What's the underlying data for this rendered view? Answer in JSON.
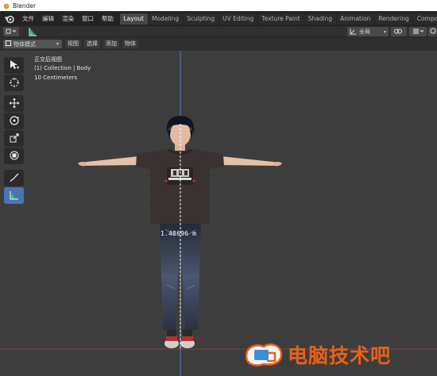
{
  "window": {
    "title": "Blender"
  },
  "menu": {
    "items": [
      "文件",
      "编辑",
      "渲染",
      "窗口",
      "帮助"
    ]
  },
  "workspaces": {
    "tabs": [
      "Layout",
      "Modeling",
      "Sculpting",
      "UV Editing",
      "Texture Paint",
      "Shading",
      "Animation",
      "Rendering",
      "Compositing"
    ],
    "active": "Layout"
  },
  "header": {
    "transform_orientation": "全局"
  },
  "viewport_header": {
    "mode": "物体模式",
    "menus": [
      "视图",
      "选择",
      "添加",
      "物体"
    ]
  },
  "overlay": {
    "view_name": "正交后视图",
    "collection": "(1) Collection | Body",
    "scale": "10 Centimeters"
  },
  "toolbar": {
    "tools": [
      "select-box",
      "cursor",
      "move",
      "rotate",
      "scale",
      "transform",
      "annotate",
      "measure"
    ],
    "active_tool": "measure"
  },
  "measurement": {
    "value": "1.48696 m"
  },
  "watermark": {
    "text": "电脑技术吧"
  },
  "colors": {
    "accent": "#4b74b5",
    "active_tab": "#474747",
    "viewport_bg": "#3d3d3d",
    "axis_y": "#5a7fb0",
    "axis_x": "#a0474a",
    "watermark": "#e8611a"
  }
}
